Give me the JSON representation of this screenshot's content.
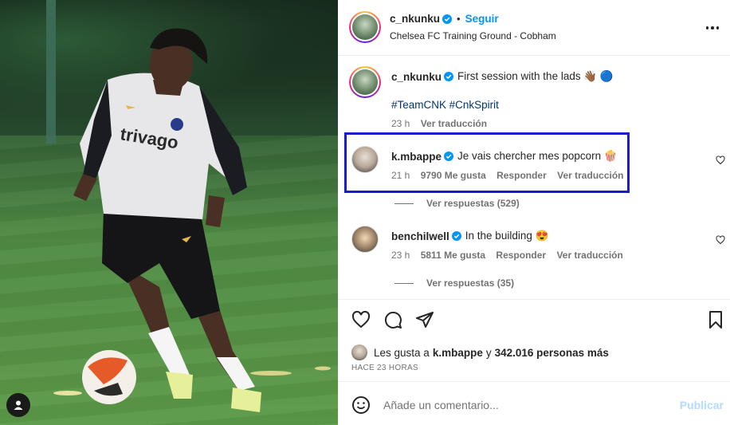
{
  "post": {
    "author": "c_nkunku",
    "follow_label": "Seguir",
    "location": "Chelsea FC Training Ground - Cobham",
    "caption": "First session with the lads 👋🏾 🔵",
    "hashtags": [
      "#TeamCNK",
      "#CnkSpirit"
    ],
    "caption_time": "23 h",
    "translate_label": "Ver traducción",
    "shirt_sponsor": "trivago"
  },
  "comments": [
    {
      "username": "k.mbappe",
      "text": "Je vais chercher mes popcorn 🍿",
      "time": "21 h",
      "likes": "9790 Me gusta",
      "reply_label": "Responder",
      "translate_label": "Ver traducción",
      "view_replies": "Ver respuestas (529)"
    },
    {
      "username": "benchilwell",
      "text": "In the building 😍",
      "time": "23 h",
      "likes": "5811 Me gusta",
      "reply_label": "Responder",
      "translate_label": "Ver traducción",
      "view_replies": "Ver respuestas (35)"
    }
  ],
  "likes_line": {
    "prefix": "Les gusta a",
    "user": "k.mbappe",
    "middle": "y",
    "count": "342.016 personas más"
  },
  "posted_ago": "HACE 23 HORAS",
  "comment_box": {
    "placeholder": "Añade un comentario...",
    "publish_label": "Publicar"
  },
  "colors": {
    "accent": "#0095f6",
    "highlight_box": "#1b1bd4",
    "publish_disabled": "#b3dbff"
  }
}
